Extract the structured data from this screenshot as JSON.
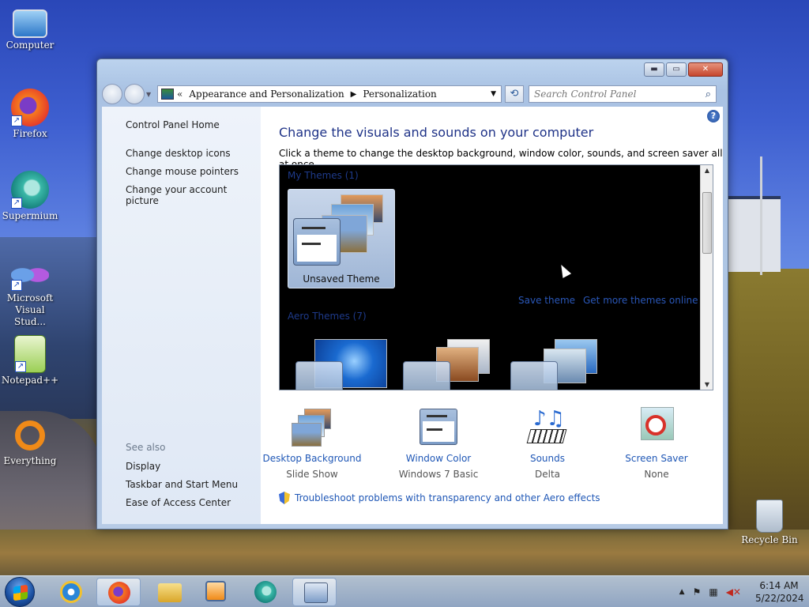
{
  "desktop": {
    "icons": [
      {
        "label": "Computer"
      },
      {
        "label": "Firefox"
      },
      {
        "label": "Supermium"
      },
      {
        "label": "Microsoft Visual Stud..."
      },
      {
        "label": "Notepad++"
      },
      {
        "label": "Everything"
      },
      {
        "label": "Recycle Bin"
      }
    ]
  },
  "window": {
    "controls": {
      "minimize": "▬",
      "maximize": "▭",
      "close": "✕"
    },
    "address": {
      "back_more": "«",
      "crumbs": [
        "Appearance and Personalization",
        "Personalization"
      ]
    },
    "search": {
      "placeholder": "Search Control Panel"
    },
    "sidebar": {
      "home": "Control Panel Home",
      "links": [
        "Change desktop icons",
        "Change mouse pointers",
        "Change your account picture"
      ],
      "see_also_label": "See also",
      "see_also": [
        "Display",
        "Taskbar and Start Menu",
        "Ease of Access Center"
      ]
    },
    "main": {
      "title": "Change the visuals and sounds on your computer",
      "subtitle": "Click a theme to change the desktop background, window color, sounds, and screen saver all at once.",
      "my_themes_label": "My Themes (1)",
      "unsaved_theme": "Unsaved Theme",
      "save_theme": "Save theme",
      "get_more": "Get more themes online",
      "aero_themes_label": "Aero Themes (7)",
      "quick": [
        {
          "label": "Desktop Background",
          "sub": "Slide Show"
        },
        {
          "label": "Window Color",
          "sub": "Windows 7 Basic"
        },
        {
          "label": "Sounds",
          "sub": "Delta"
        },
        {
          "label": "Screen Saver",
          "sub": "None"
        }
      ],
      "troubleshoot": "Troubleshoot problems with transparency and other Aero effects"
    }
  },
  "taskbar": {
    "clock_time": "6:14 AM",
    "clock_date": "5/22/2024",
    "tray_up": "▲"
  }
}
